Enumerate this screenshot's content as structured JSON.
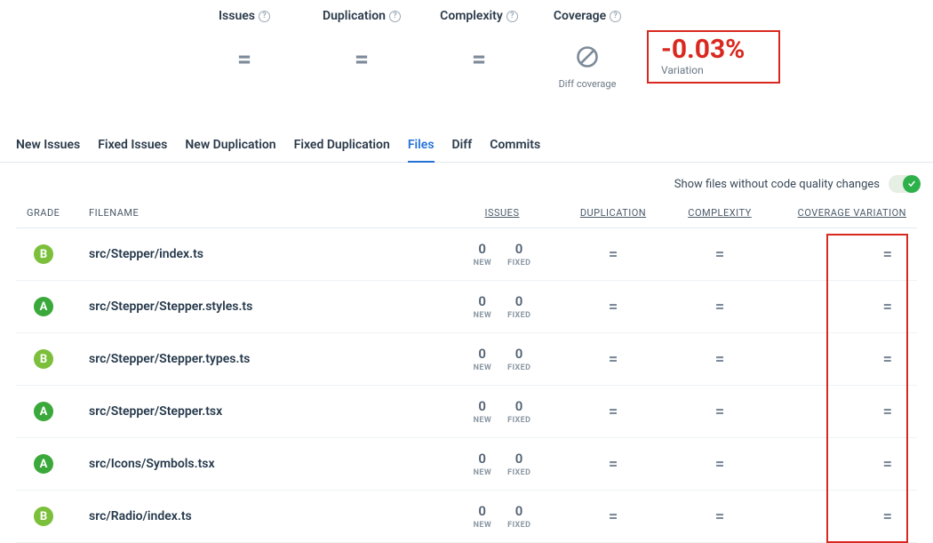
{
  "metrics": {
    "issues_label": "Issues",
    "duplication_label": "Duplication",
    "complexity_label": "Complexity",
    "coverage_label": "Coverage",
    "equal": "=",
    "diff_coverage_label": "Diff coverage",
    "variation_value": "-0.03%",
    "variation_label": "Variation"
  },
  "tabs": [
    {
      "label": "New Issues",
      "active": false
    },
    {
      "label": "Fixed Issues",
      "active": false
    },
    {
      "label": "New Duplication",
      "active": false
    },
    {
      "label": "Fixed Duplication",
      "active": false
    },
    {
      "label": "Files",
      "active": true
    },
    {
      "label": "Diff",
      "active": false
    },
    {
      "label": "Commits",
      "active": false
    }
  ],
  "toggle": {
    "label": "Show files without code quality changes"
  },
  "columns": {
    "grade": "GRADE",
    "filename": "FILENAME",
    "issues": "ISSUES",
    "duplication": "DUPLICATION",
    "complexity": "COMPLEXITY",
    "coverage": "COVERAGE VARIATION",
    "new": "NEW",
    "fixed": "FIXED"
  },
  "rows": [
    {
      "grade": "B",
      "filename": "src/Stepper/index.ts",
      "new": 0,
      "fixed": 0,
      "dup": "=",
      "cx": "=",
      "cov": "="
    },
    {
      "grade": "A",
      "filename": "src/Stepper/Stepper.styles.ts",
      "new": 0,
      "fixed": 0,
      "dup": "=",
      "cx": "=",
      "cov": "="
    },
    {
      "grade": "B",
      "filename": "src/Stepper/Stepper.types.ts",
      "new": 0,
      "fixed": 0,
      "dup": "=",
      "cx": "=",
      "cov": "="
    },
    {
      "grade": "A",
      "filename": "src/Stepper/Stepper.tsx",
      "new": 0,
      "fixed": 0,
      "dup": "=",
      "cx": "=",
      "cov": "="
    },
    {
      "grade": "A",
      "filename": "src/Icons/Symbols.tsx",
      "new": 0,
      "fixed": 0,
      "dup": "=",
      "cx": "=",
      "cov": "="
    },
    {
      "grade": "B",
      "filename": "src/Radio/index.ts",
      "new": 0,
      "fixed": 0,
      "dup": "=",
      "cx": "=",
      "cov": "="
    }
  ]
}
